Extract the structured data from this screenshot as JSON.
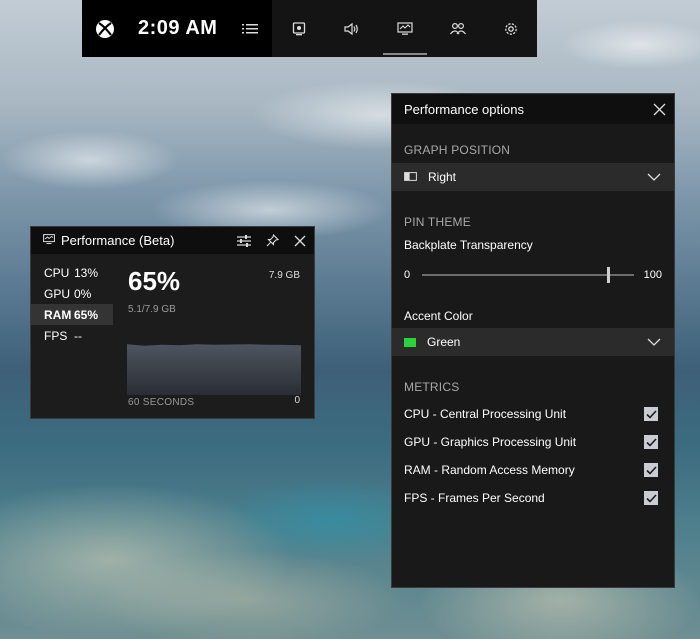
{
  "gamebar": {
    "time": "2:09 AM",
    "icons": [
      "xbox-logo-icon",
      "menu-icon",
      "capture-icon",
      "audio-icon",
      "performance-icon",
      "social-icon",
      "settings-icon"
    ]
  },
  "perf_widget": {
    "title": "Performance (Beta)",
    "metrics": [
      {
        "name": "CPU",
        "value": "13%"
      },
      {
        "name": "GPU",
        "value": "0%"
      },
      {
        "name": "RAM",
        "value": "65%"
      },
      {
        "name": "FPS",
        "value": "--"
      }
    ],
    "selected_metric": "RAM",
    "big_value": "65%",
    "total": "7.9 GB",
    "used": "5.1/7.9 GB",
    "duration_label": "60 SECONDS",
    "min_label": "0",
    "graph_level": 0.65
  },
  "options": {
    "title": "Performance options",
    "graph_position": {
      "heading": "GRAPH POSITION",
      "value": "Right"
    },
    "pin_theme": {
      "heading": "PIN THEME",
      "transparency_label": "Backplate Transparency",
      "slider_min": "0",
      "slider_max": "100",
      "slider_value": 88
    },
    "accent": {
      "label": "Accent Color",
      "value": "Green",
      "color": "#2bd33b"
    },
    "metrics": {
      "heading": "METRICS",
      "items": [
        {
          "label": "CPU - Central Processing Unit",
          "checked": true
        },
        {
          "label": "GPU - Graphics Processing Unit",
          "checked": true
        },
        {
          "label": "RAM - Random Access Memory",
          "checked": true
        },
        {
          "label": "FPS - Frames Per Second",
          "checked": true
        }
      ]
    }
  }
}
